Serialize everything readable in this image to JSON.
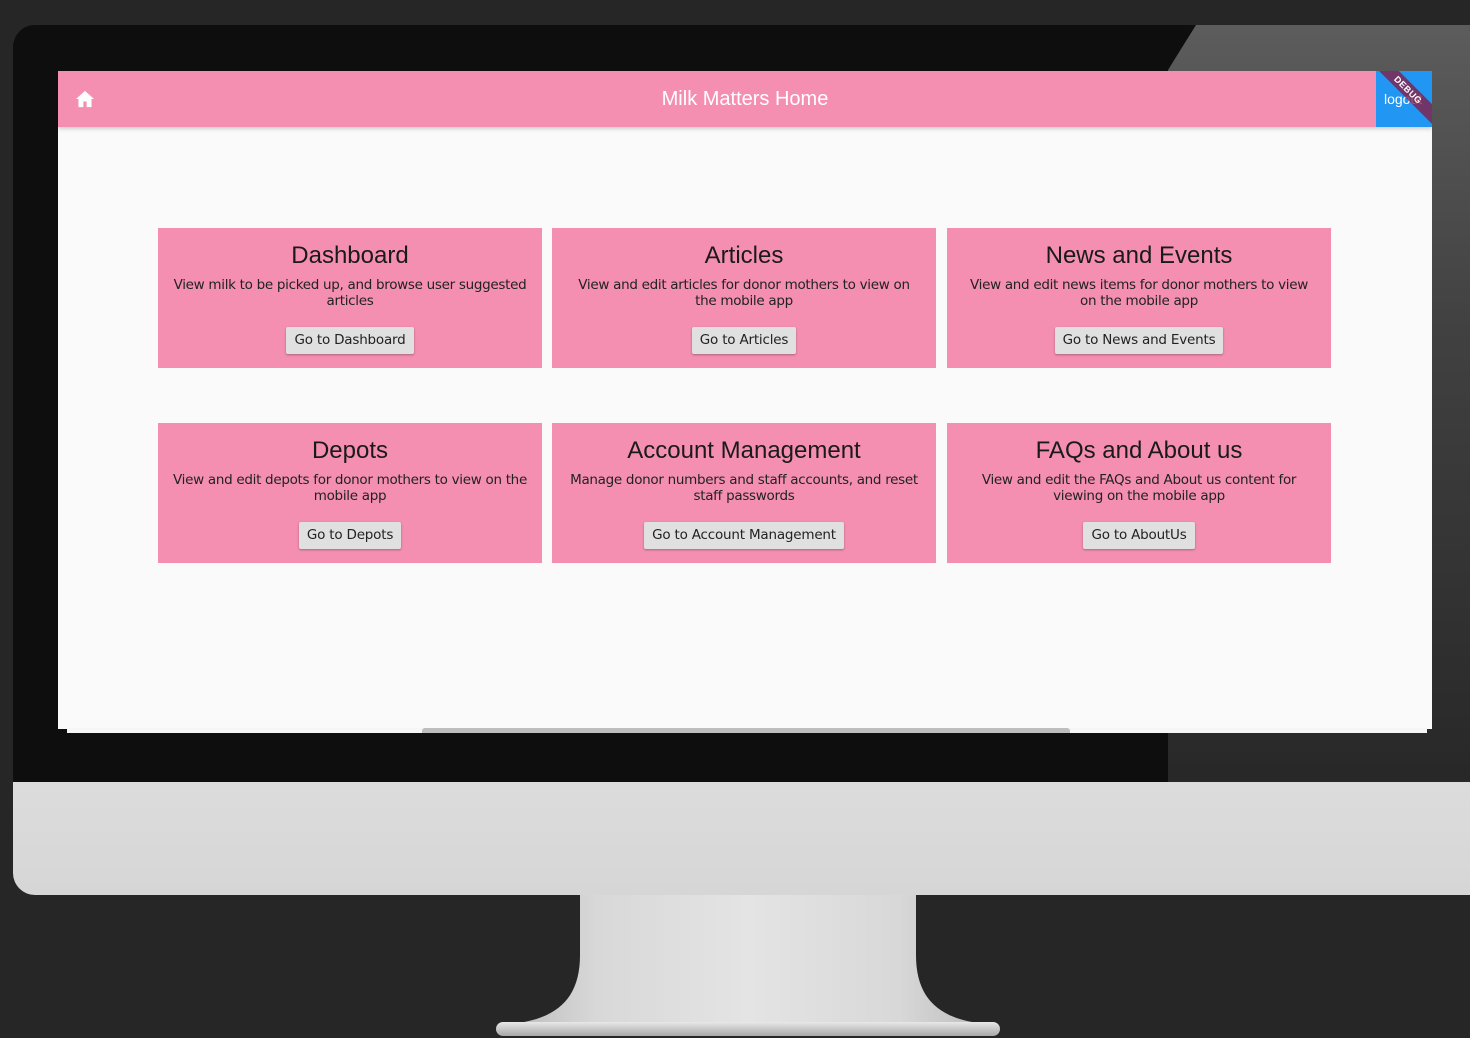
{
  "appbar": {
    "title": "Milk Matters Home",
    "logout_label": "logout",
    "debug_label": "DEBUG"
  },
  "cards": [
    {
      "title": "Dashboard",
      "description": "View milk to be picked up, and browse user suggested articles",
      "button": "Go to Dashboard"
    },
    {
      "title": "Articles",
      "description": "View and edit articles for donor mothers to view on the mobile app",
      "button": "Go to Articles"
    },
    {
      "title": "News and Events",
      "description": "View and edit news items for donor mothers to view on the mobile app",
      "button": "Go to News and Events"
    },
    {
      "title": "Depots",
      "description": "View and edit depots for donor mothers to view on the mobile app",
      "button": "Go to Depots"
    },
    {
      "title": "Account Management",
      "description": "Manage donor numbers and staff accounts, and reset staff passwords",
      "button": "Go to Account Management"
    },
    {
      "title": "FAQs and About us",
      "description": "View and edit the FAQs and About us content for viewing on the mobile app",
      "button": "Go to AboutUs"
    }
  ],
  "colors": {
    "appbar": "#f48fb1",
    "card": "#f48fb1",
    "logout": "#2196f3",
    "background": "#fafafa"
  },
  "icons": {
    "home": "home-icon"
  }
}
